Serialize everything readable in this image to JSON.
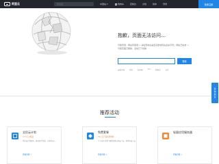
{
  "header": {
    "logo_text": "阿里云",
    "search_placeholder": "搜全站",
    "region": "中国站",
    "nav": [
      "购物车",
      "控制台",
      "文档",
      "简体",
      "登录"
    ],
    "register_label": "免费注册"
  },
  "error": {
    "title": "抱歉，页面无法访问…",
    "description": "可能原因：网址有错误 > 请检查地址是否完整或存在多余字符；网址已失效 > 可能页面已删除，活动已下线等",
    "search_placeholder": "",
    "search_button": "搜索",
    "hot_links": [
      "云服务器",
      "域名",
      "服务器",
      "SSL",
      "数据库",
      "安全"
    ]
  },
  "recommend": {
    "title": "推荐活动",
    "cards": [
      {
        "title": "全民云计划",
        "subtitle": "0.73元/1核起",
        "description": "用好云计算服务，建站助手免费，只要你加入",
        "link": "查看详情 >"
      },
      {
        "title": "免费套餐",
        "subtitle": "30+云产品免费体验",
        "description": "个人和企业用户都能免费试用云产品，帮你快速上云",
        "link": "查看详情 >"
      },
      {
        "title": "轻量应用服务器",
        "subtitle": "",
        "description": "",
        "link": "查看详情 >"
      }
    ]
  },
  "side": {
    "label": "咨询建议"
  },
  "colors": {
    "header_bg": "#23262e",
    "accent": "#1f86e8",
    "orange": "#f08a3b"
  }
}
